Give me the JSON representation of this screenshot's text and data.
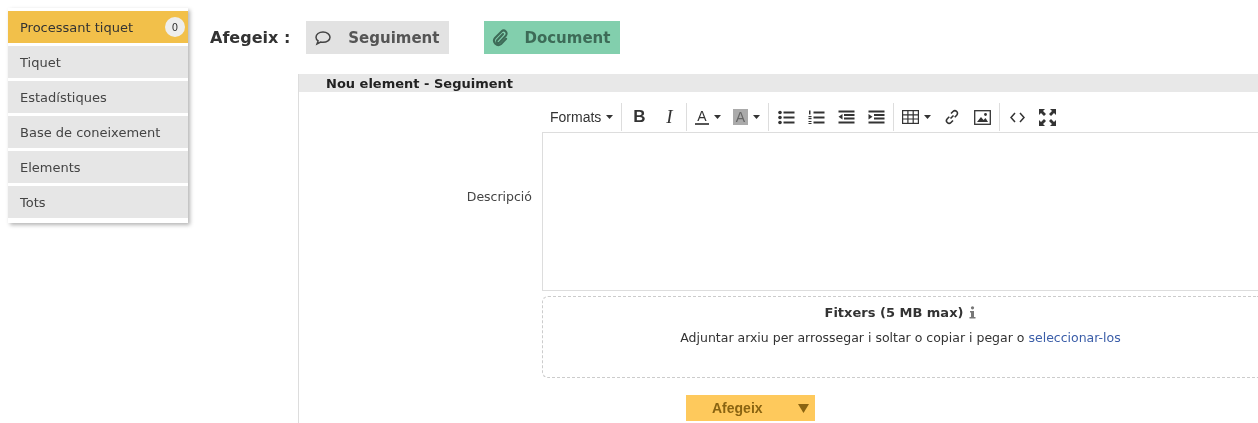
{
  "sidebar": {
    "items": [
      {
        "label": "Processant tiquet",
        "selected": true,
        "badge": "0"
      },
      {
        "label": "Tiquet",
        "selected": false
      },
      {
        "label": "Estadístiques",
        "selected": false
      },
      {
        "label": "Base de coneixement",
        "selected": false
      },
      {
        "label": "Elements",
        "selected": false
      },
      {
        "label": "Tots",
        "selected": false
      }
    ]
  },
  "add_bar": {
    "label": "Afegeix :",
    "buttons": [
      {
        "kind": "followup",
        "label": "Seguiment",
        "selected": false
      },
      {
        "kind": "document",
        "label": "Document",
        "selected": true
      }
    ]
  },
  "panel": {
    "title": "Nou element - Seguiment",
    "field_label": "Descripció",
    "toolbar": [
      [
        {
          "kind": "menu",
          "label": "Formats"
        }
      ],
      [
        {
          "kind": "bold",
          "label": "B"
        },
        {
          "kind": "italic",
          "label": "I"
        }
      ],
      [
        {
          "kind": "text-color",
          "label": "A"
        },
        {
          "kind": "background-color",
          "label": "A"
        }
      ],
      [
        {
          "kind": "bullet-list"
        },
        {
          "kind": "numbered-list"
        },
        {
          "kind": "outdent"
        },
        {
          "kind": "indent"
        }
      ],
      [
        {
          "kind": "table"
        },
        {
          "kind": "link"
        },
        {
          "kind": "image"
        }
      ],
      [
        {
          "kind": "code"
        },
        {
          "kind": "fullscreen"
        }
      ]
    ],
    "files": {
      "title": "Fitxers (5 MB max)",
      "hint": "Adjuntar arxiu per arrossegar i soltar o copiar i pegar o",
      "link": "seleccionar-los"
    },
    "submit": {
      "label": "Afegeix"
    }
  }
}
